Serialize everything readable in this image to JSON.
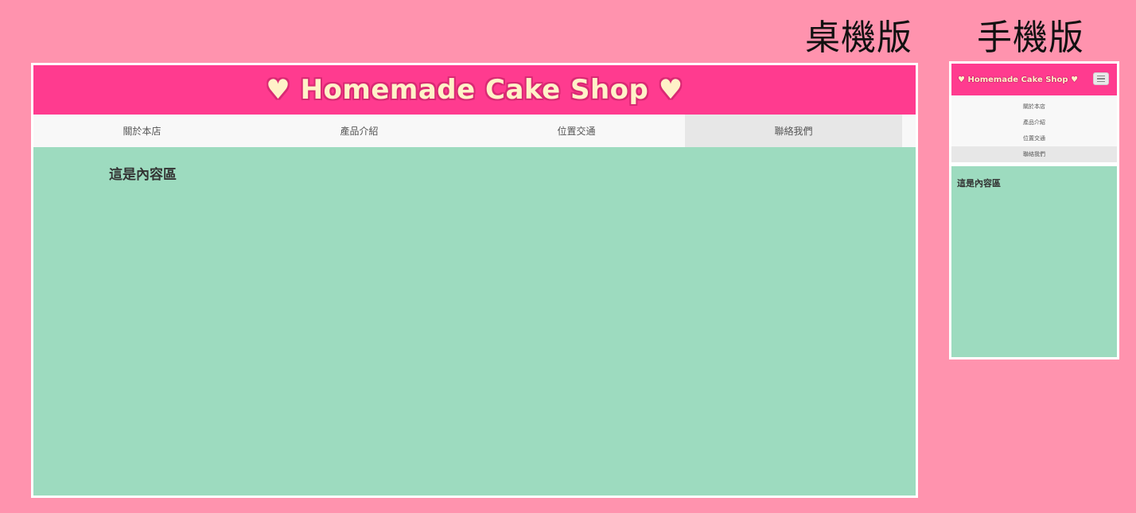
{
  "labels": {
    "desktop": "桌機版",
    "mobile": "手機版"
  },
  "site": {
    "heart": "♥",
    "title": "Homemade Cake Shop",
    "nav": [
      "關於本店",
      "產品介紹",
      "位置交通",
      "聯絡我們"
    ],
    "active_nav": "聯絡我們",
    "content_heading": "這是內容區"
  },
  "icons": {
    "menu": "hamburger-menu-icon",
    "heart": "heart-icon"
  },
  "colors": {
    "page_background": "#ff93ae",
    "header": "#ff3b8f",
    "title_fill": "#fff2c8",
    "nav_background": "#f8f8f8",
    "nav_active": "#e7e7e7",
    "content_background": "#9ddbbf"
  }
}
